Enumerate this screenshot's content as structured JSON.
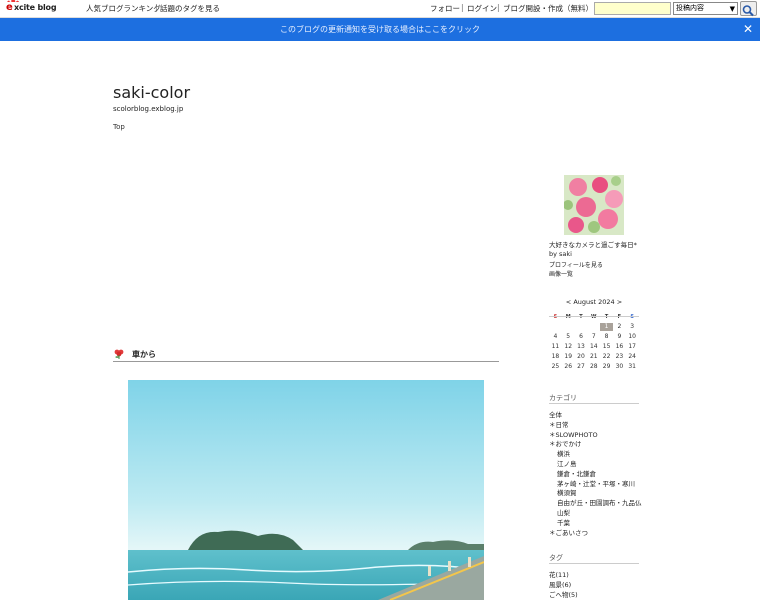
{
  "topbar": {
    "logo_prefix": "e",
    "logo_text": "xcite blog",
    "ranking_link": "人気ブログランキング",
    "tags_link": "話題のタグを見る",
    "follow": "フォロー",
    "login": "ログイン",
    "create_blog": "ブログ開設・作成（無料）",
    "search_value": "",
    "search_select": "投稿内容"
  },
  "notification": {
    "text": "このブログの更新通知を受け取る場合はここをクリック",
    "close": "✕"
  },
  "blog": {
    "title": "saki-color",
    "url": "scolorblog.exblog.jp",
    "top_link": "Top"
  },
  "post": {
    "title": "車から"
  },
  "profile": {
    "description": "大好きなカメラと過ごす毎日*",
    "author": "by saki",
    "profile_link": "プロフィールを見る",
    "images_link": "画像一覧"
  },
  "calendar": {
    "prev": "<",
    "month": "August 2024",
    "next": ">",
    "days_of_week": [
      "S",
      "M",
      "T",
      "W",
      "T",
      "F",
      "S"
    ],
    "leading_blanks": 4,
    "today": "1",
    "days": [
      "1",
      "2",
      "3",
      "4",
      "5",
      "6",
      "7",
      "8",
      "9",
      "10",
      "11",
      "12",
      "13",
      "14",
      "15",
      "16",
      "17",
      "18",
      "19",
      "20",
      "21",
      "22",
      "23",
      "24",
      "25",
      "26",
      "27",
      "28",
      "29",
      "30",
      "31"
    ]
  },
  "categories": {
    "heading": "カテゴリ",
    "items": [
      {
        "label": "全体",
        "indent": 0
      },
      {
        "label": "＊日常",
        "indent": 0
      },
      {
        "label": "＊SLOWPHOTO",
        "indent": 0
      },
      {
        "label": "＊おでかけ",
        "indent": 0
      },
      {
        "label": "横浜",
        "indent": 1
      },
      {
        "label": "江ノ島",
        "indent": 1
      },
      {
        "label": "鎌倉・北鎌倉",
        "indent": 1
      },
      {
        "label": "茅ヶ崎・辻堂・平塚・寒川",
        "indent": 1
      },
      {
        "label": "横須賀",
        "indent": 1
      },
      {
        "label": "自由が丘・田園調布・九品仏",
        "indent": 1
      },
      {
        "label": "山梨",
        "indent": 1
      },
      {
        "label": "千葉",
        "indent": 1
      },
      {
        "label": "＊ごあいさつ",
        "indent": 0
      }
    ]
  },
  "tags": {
    "heading": "タグ",
    "items": [
      "花(11)",
      "風景(6)",
      "ごへ物(5)"
    ]
  }
}
